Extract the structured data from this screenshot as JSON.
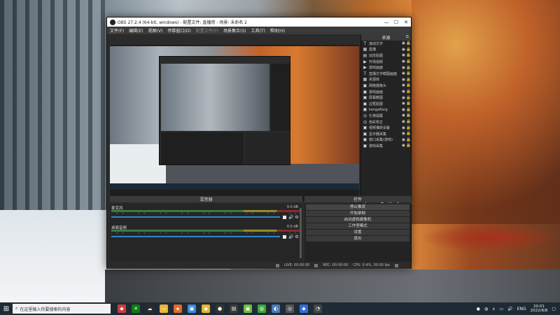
{
  "window": {
    "title": "OBS 27.2.4 (64-bit, windows) - 配置文件: 直播用 - 场景: 未命名 2",
    "minimize": "—",
    "maximize": "☐",
    "close": "✕"
  },
  "menu": [
    "文件(F)",
    "编辑(E)",
    "视图(V)",
    "停靠窗口(D)",
    "配置文件(P)",
    "场景集合(S)",
    "工具(T)",
    "帮助(H)"
  ],
  "sources": {
    "title": "来源",
    "items": [
      {
        "icon": "T",
        "name": "滚动文字"
      },
      {
        "icon": "▦",
        "name": "直播"
      },
      {
        "icon": "▤",
        "name": "动态贴图"
      },
      {
        "icon": "▶",
        "name": "开场视频"
      },
      {
        "icon": "▶",
        "name": "游戏画面"
      },
      {
        "icon": "T",
        "name": "直播文字截图画面"
      },
      {
        "icon": "▦",
        "name": "资源库"
      },
      {
        "icon": "▣",
        "name": "网络摄像头"
      },
      {
        "icon": "▣",
        "name": "游戏画面"
      },
      {
        "icon": "▣",
        "name": "屏幕截图"
      },
      {
        "icon": "▣",
        "name": "边框贴图"
      },
      {
        "icon": "▣",
        "name": "kangaflarg"
      },
      {
        "icon": "◎",
        "name": "礼物提醒"
      },
      {
        "icon": "◎",
        "name": "色彩校正"
      },
      {
        "icon": "▣",
        "name": "视频捕获设备"
      },
      {
        "icon": "▣",
        "name": "显示器采集"
      },
      {
        "icon": "▣",
        "name": "窗口采集(游戏)"
      },
      {
        "icon": "▣",
        "name": "游戏采集"
      }
    ],
    "tools": [
      "+",
      "−",
      "⚙",
      "∧",
      "∨"
    ]
  },
  "mixer": {
    "title": "混音器",
    "channels": [
      {
        "name": "麦克风",
        "db": "0.0 dB"
      },
      {
        "name": "桌面音频",
        "db": "0.0 dB"
      }
    ],
    "ticks": "-60 -55 -50 -45 -40 -35 -30 -25 -20 -15 -10 -5 0"
  },
  "controls": {
    "title": "控件",
    "buttons": [
      "停止推流",
      "开始录制",
      "启动虚拟摄像机",
      "工作室模式",
      "设置",
      "退出"
    ]
  },
  "status": {
    "dropped": "LIVE: 00:00:00",
    "rec": "REC: 00:00:00",
    "cpu": "CPU: 0.4%, 30.00 fps"
  },
  "taskbar": {
    "search_placeholder": "在这里输入你要搜索的内容",
    "lang": "ENG",
    "time": "20:01",
    "date": "2022/8/8"
  },
  "colors": {
    "obs_bg": "#2b2b2b",
    "fader": "#2f86c9",
    "meter_green": "#3c7a3c",
    "taskbar": "#1f2b34"
  }
}
